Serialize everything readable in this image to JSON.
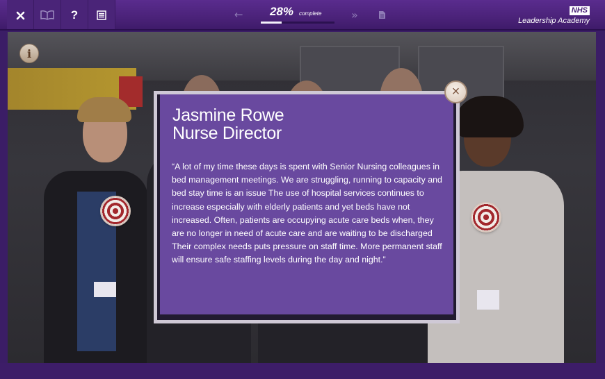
{
  "toolbar": {
    "close_icon": "close-icon",
    "book_icon": "book-icon",
    "help_label": "?",
    "menu_icon": "list-icon",
    "back_arrow": "←",
    "forward_arrow": "»",
    "page_icon": "page-icon"
  },
  "progress": {
    "percent_text": "28%",
    "label": "complete",
    "fraction": 0.28
  },
  "brand": {
    "logo": "NHS",
    "name": "Leadership Academy"
  },
  "scene": {
    "info_label": "i"
  },
  "popup": {
    "name": "Jasmine Rowe",
    "role": "Nurse Director",
    "quote": "“A lot of my time these days is spent with Senior Nursing colleagues in bed management meetings. We are struggling, running to capacity and bed stay time is an issue The use of hospital services continues to increase especially with elderly patients and yet beds have not increased. Often, patients are occupying acute care beds when, they are no longer in need of acute care and are waiting to be discharged Their complex needs puts pressure on staff time. More permanent staff will ensure safe staffing levels during the day and night.”",
    "close_label": "×"
  },
  "colors": {
    "brand_purple": "#4a2278",
    "popup_purple": "#6f4ca8",
    "target_red": "#a2282d"
  }
}
